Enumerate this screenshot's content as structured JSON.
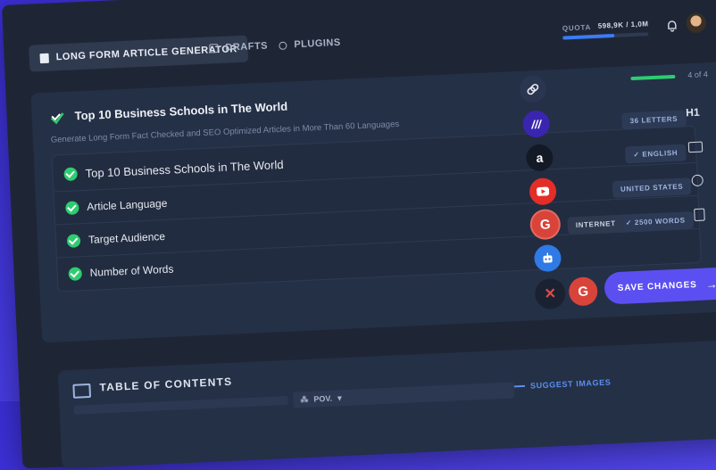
{
  "header": {
    "tabs": [
      {
        "label": "LONG FORM ARTICLE GENERATOR",
        "active": true,
        "icon": "document-icon"
      },
      {
        "label": "DRAFTS",
        "active": false,
        "icon": "drafts-icon"
      },
      {
        "label": "PLUGINS",
        "active": false,
        "icon": "plugins-icon"
      }
    ],
    "quota": {
      "label": "QUOTA",
      "value": "598,9K / 1,0M",
      "progress": 0.599
    }
  },
  "article": {
    "title": "Top 10 Business Schools in The World",
    "subtitle": "Generate Long Form Fact Checked and SEO Optimized Articles in More Than 60 Languages",
    "progress_text": "4 of 4",
    "progress": 1.0,
    "rows": [
      {
        "label": "Top 10 Business Schools in The World",
        "badge": "36 LETTERS",
        "icon": "H1"
      },
      {
        "label": "Article Language",
        "badge": "✓ ENGLISH",
        "icon": "language-icon"
      },
      {
        "label": "Target Audience",
        "badge": "UNITED STATES",
        "icon": "globe-icon"
      },
      {
        "label": "Number of Words",
        "badge": "✓ 2500 WORDS",
        "icon": "word-count-icon"
      }
    ]
  },
  "plugins": {
    "items": [
      "link-icon",
      "midjourney-icon",
      "amazon-icon",
      "youtube-icon",
      "google-icon",
      "robot-icon"
    ],
    "internet_label": "INTERNET"
  },
  "actions": {
    "save_label": "SAVE CHANGES"
  },
  "toc": {
    "title": "TABLE OF CONTENTS",
    "pov_label": "POV.",
    "suggest_images_label": "SUGGEST IMAGES"
  },
  "colors": {
    "accent": "#5b4ff2",
    "success": "#2ecc71",
    "quota_bar": "#3d7bf5",
    "panel": "#243046"
  }
}
